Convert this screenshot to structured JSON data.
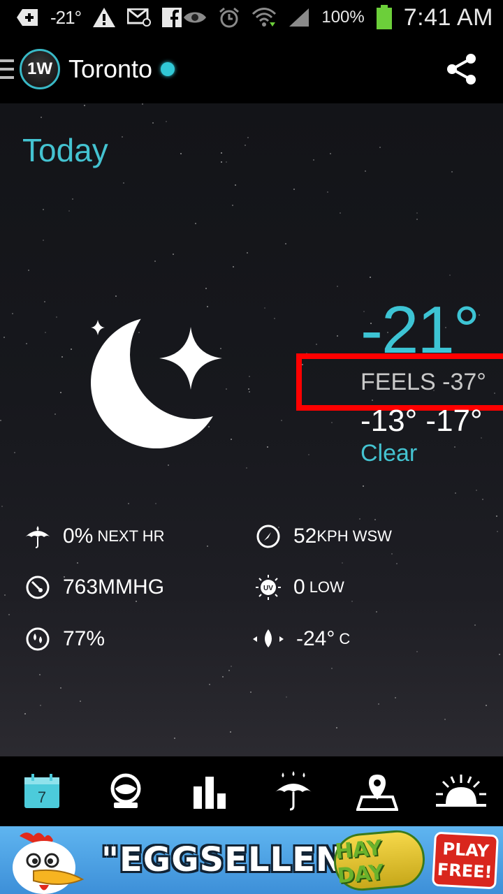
{
  "status_bar": {
    "temp": "-21°",
    "battery_pct": "100%",
    "time": "7:41 AM",
    "icons": [
      "plus-cross-icon",
      "warning-icon",
      "email-icon",
      "facebook-icon",
      "eye-icon",
      "alarm-icon",
      "wifi-icon",
      "signal-icon",
      "battery-icon"
    ]
  },
  "header": {
    "city": "Toronto",
    "logo_text": "1W",
    "share_icon": "share-icon"
  },
  "main": {
    "day_label": "Today",
    "temperature": "-21°",
    "feels_like": "FEELS -37°",
    "hi_lo": "-13° -17°",
    "condition": "Clear",
    "condition_icon": "moon-star-icon"
  },
  "details": [
    {
      "icon": "umbrella-drop-icon",
      "value": "0%",
      "unit": "NEXT HR"
    },
    {
      "icon": "wind-icon",
      "value": "52",
      "unit": "KPH WSW"
    },
    {
      "icon": "pressure-gauge-icon",
      "value": "763MMHG",
      "unit": ""
    },
    {
      "icon": "uv-sun-icon",
      "value": "0",
      "unit": "LOW"
    },
    {
      "icon": "humidity-icon",
      "value": "77%",
      "unit": ""
    },
    {
      "icon": "dewpoint-icon",
      "value": "-24°",
      "unit": "C"
    }
  ],
  "bottom_nav": {
    "calendar_day": "7",
    "items": [
      "calendar-icon",
      "globe-icon",
      "bar-chart-icon",
      "umbrella-rain-icon",
      "map-pin-icon",
      "sunrise-icon"
    ]
  },
  "ad": {
    "headline": "\"EGGSELLENT\"",
    "brand": "HAY DAY",
    "cta": "PLAY FREE!"
  },
  "colors": {
    "accent": "#3dc4d4",
    "highlight": "#ff0000",
    "background": "#17181d"
  }
}
